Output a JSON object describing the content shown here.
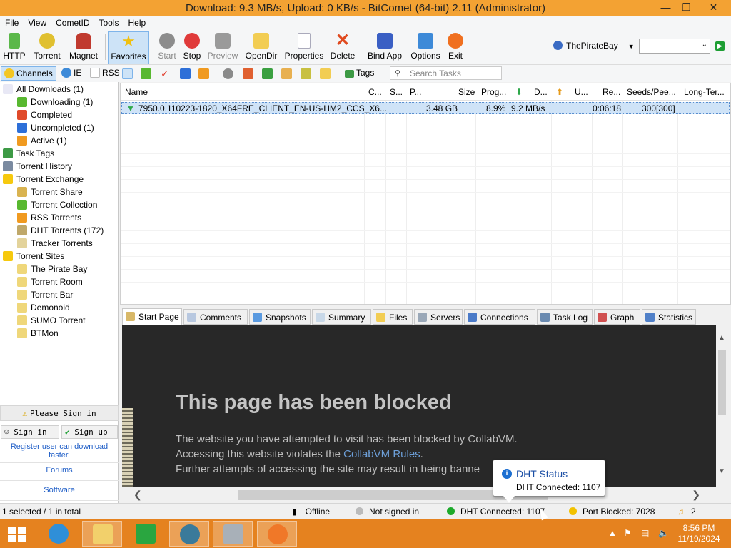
{
  "window": {
    "title": "Download: 9.3 MB/s, Upload: 0 KB/s - BitComet (64-bit) 2.11 (Administrator)"
  },
  "menu": [
    "File",
    "View",
    "CometID",
    "Tools",
    "Help"
  ],
  "toolbar": {
    "buttons": [
      "HTTP",
      "Torrent",
      "Magnet",
      "Favorites",
      "Start",
      "Stop",
      "Preview",
      "OpenDir",
      "Properties",
      "Delete",
      "Bind App",
      "Options",
      "Exit"
    ],
    "site": "ThePirateBay",
    "combo_value": ""
  },
  "subbar": {
    "channels": "Channels",
    "ie": "IE",
    "rss": "RSS",
    "tags": "Tags",
    "search_placeholder": "Search Tasks"
  },
  "sidebar": {
    "items": [
      {
        "label": "All Downloads (1)",
        "icon": "all-downloads-icon",
        "color": "#e8e8f5"
      },
      {
        "label": "Downloading (1)",
        "icon": "download-arrow-icon",
        "color": "#58b830"
      },
      {
        "label": "Completed",
        "icon": "check-icon",
        "color": "#e04a2a"
      },
      {
        "label": "Uncompleted (1)",
        "icon": "uncompleted-icon",
        "color": "#2d6fd8"
      },
      {
        "label": "Active (1)",
        "icon": "active-icon",
        "color": "#f09a20"
      },
      {
        "label": "Task Tags",
        "icon": "tags-icon",
        "color": "#3d9a45"
      },
      {
        "label": "Torrent History",
        "icon": "history-icon",
        "color": "#7a8aa0"
      },
      {
        "label": "Torrent Exchange",
        "icon": "star-icon",
        "color": "#f6c90e"
      },
      {
        "label": "Torrent Share",
        "icon": "torrent-file-icon",
        "color": "#d9b350"
      },
      {
        "label": "Torrent Collection",
        "icon": "torrent-file-icon",
        "color": "#58b830"
      },
      {
        "label": "RSS Torrents",
        "icon": "torrent-file-icon",
        "color": "#f09a20"
      },
      {
        "label": "DHT Torrents (172)",
        "icon": "torrent-file-icon",
        "color": "#bfa86a"
      },
      {
        "label": "Tracker Torrents",
        "icon": "torrent-file-icon",
        "color": "#e3d39b"
      },
      {
        "label": "Torrent Sites",
        "icon": "star-icon",
        "color": "#f6c90e"
      },
      {
        "label": "The Pirate Bay",
        "icon": "site-icon",
        "color": "#efd77a"
      },
      {
        "label": "Torrent Room",
        "icon": "site-icon",
        "color": "#efd77a"
      },
      {
        "label": "Torrent Bar",
        "icon": "site-icon",
        "color": "#efd77a"
      },
      {
        "label": "Demonoid",
        "icon": "site-icon",
        "color": "#efd77a"
      },
      {
        "label": "SUMO Torrent",
        "icon": "site-icon",
        "color": "#efd77a"
      },
      {
        "label": "BTMon",
        "icon": "site-icon",
        "color": "#efd77a"
      }
    ],
    "please_sign_in": "Please Sign in",
    "sign_in": "Sign in",
    "sign_up": "Sign up",
    "register_note": "Register user can download faster.",
    "forums": "Forums",
    "software": "Software"
  },
  "tasklist": {
    "columns": [
      "Name",
      "C...",
      "S...",
      "P...",
      "Size",
      "Prog...",
      "D...",
      "U...",
      "Re...",
      "Seeds/Pee...",
      "Long-Ter..."
    ],
    "rows": [
      {
        "name": "7950.0.110223-1820_X64FRE_CLIENT_EN-US-HM2_CCS_X6...",
        "size": "3.48 GB",
        "progress": "8.9%",
        "down": "9.2 MB/s",
        "remaining": "0:06:18",
        "seeds": "300[300]"
      }
    ]
  },
  "tabs": [
    "Start Page",
    "Comments",
    "Snapshots",
    "Summary",
    "Files",
    "Servers",
    "Connections",
    "Task Log",
    "Graph",
    "Statistics"
  ],
  "pane": {
    "heading": "This page has been blocked",
    "line1": "The website you have attempted to visit has been blocked by CollabVM.",
    "line2_pre": "Accessing this website violates the ",
    "line2_link": "CollabVM Rules",
    "line2_post": ".",
    "line3": "Further attempts of accessing the site may result in being banne"
  },
  "tooltip": {
    "title": "DHT Status",
    "body": "DHT Connected: 1107"
  },
  "status": {
    "selected": "1 selected / 1 in total",
    "offline": "Offline",
    "not_signed": "Not signed in",
    "dht": "DHT Connected: 1107",
    "port": "Port Blocked: 7028",
    "alerts": "2"
  },
  "taskbar": {
    "time": "8:56 PM",
    "date": "11/19/2024"
  },
  "colors": {
    "title_bar": "#f3a233",
    "taskbar": "#e5821f",
    "selection": "#cfe3f7",
    "pane_bg": "#282828",
    "link": "#1f5ec7"
  }
}
